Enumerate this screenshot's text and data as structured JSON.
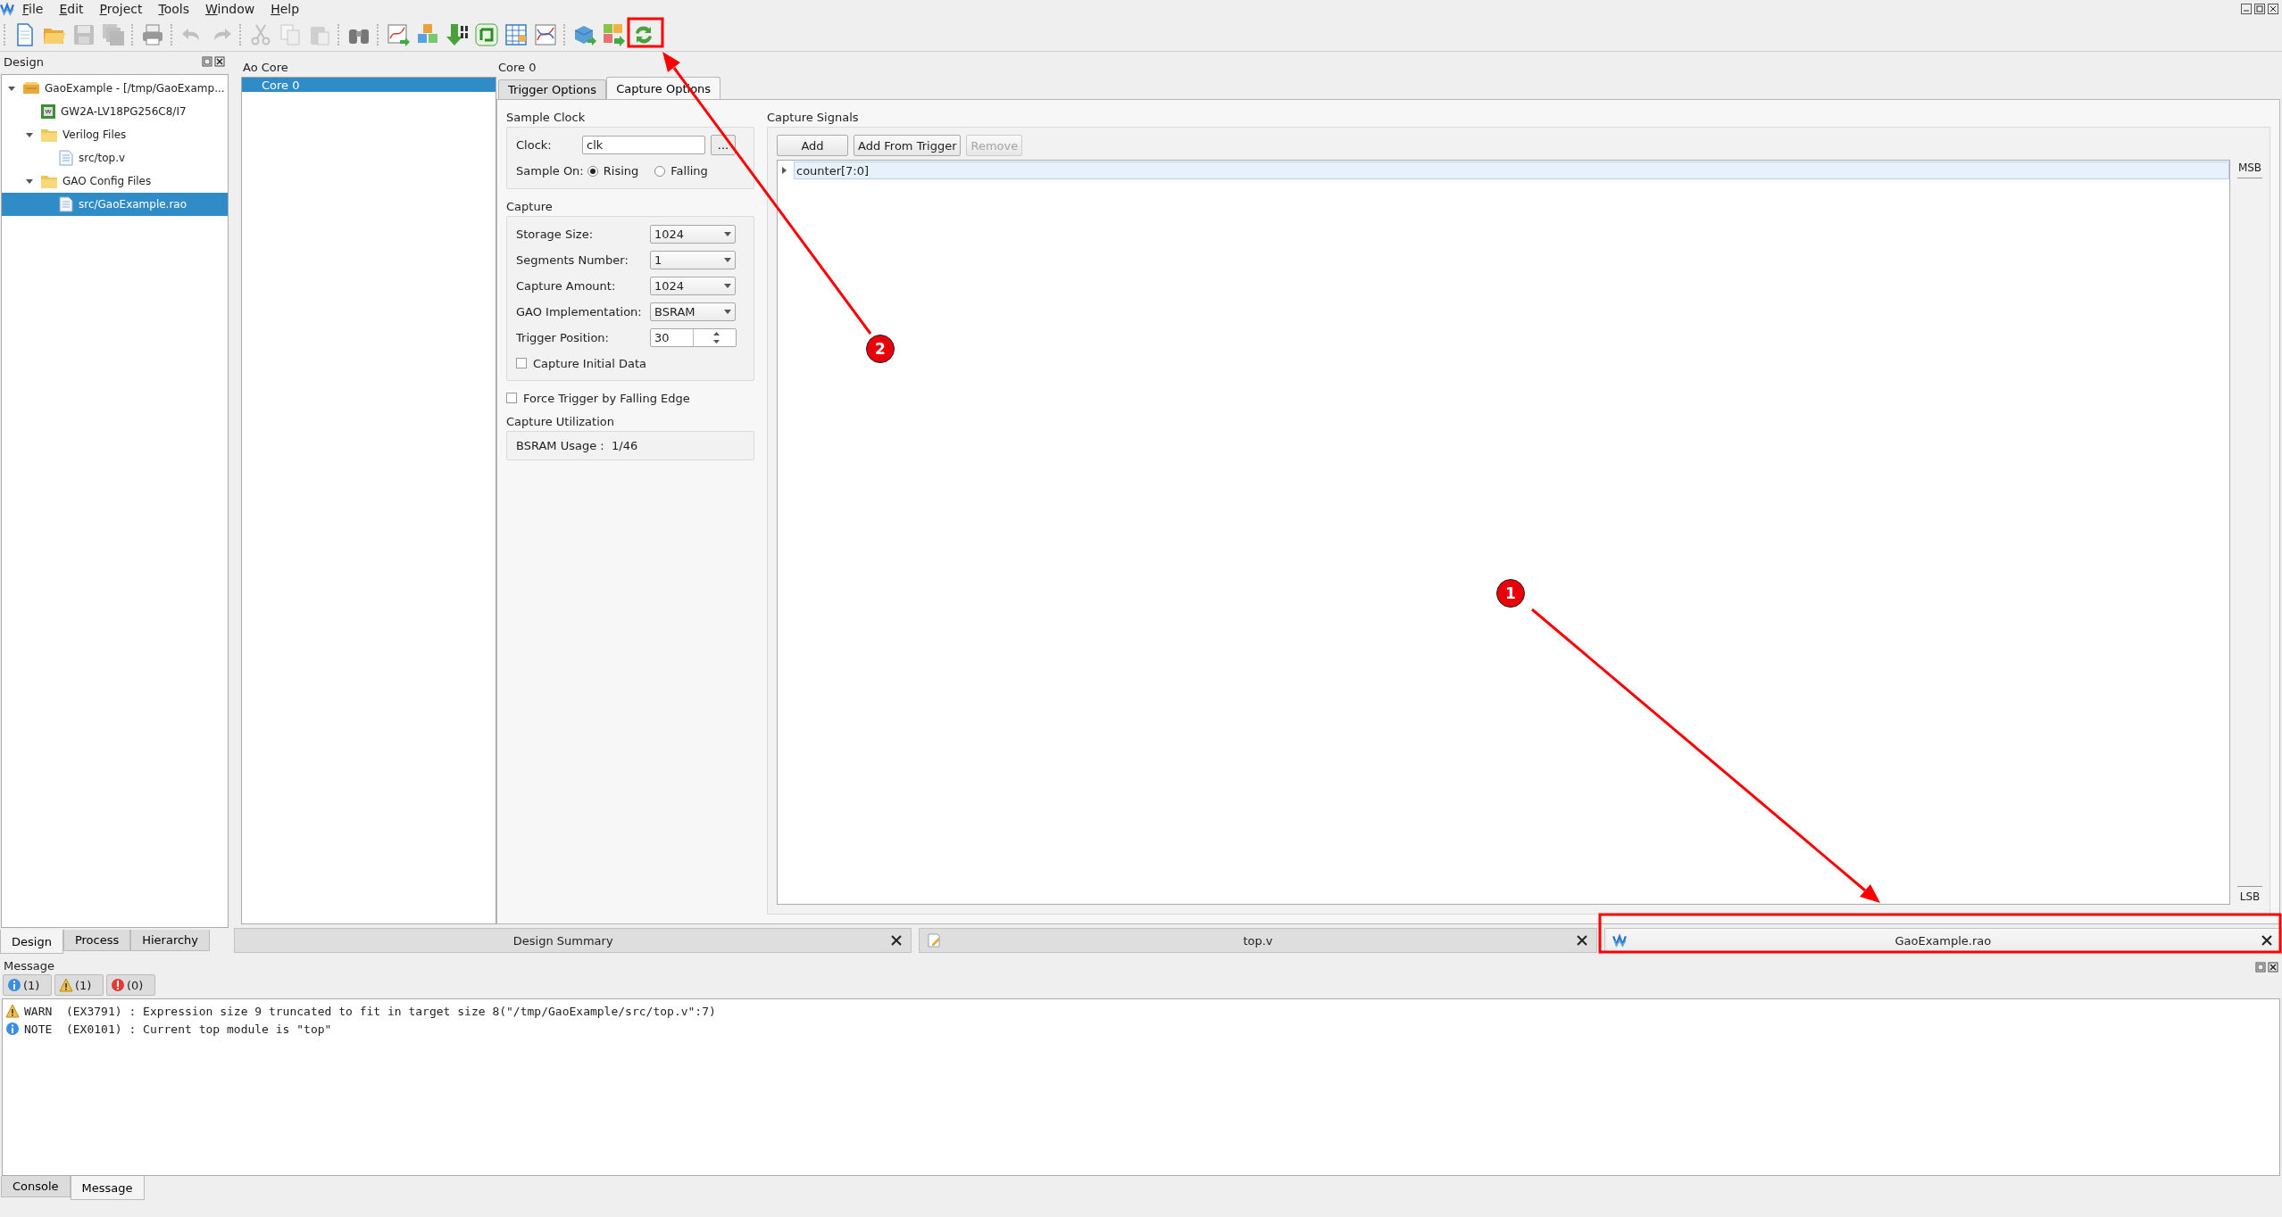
{
  "menu": [
    "File",
    "Edit",
    "Project",
    "Tools",
    "Window",
    "Help"
  ],
  "toolbar": [
    {
      "disabled": false
    },
    {
      "disabled": false
    },
    {
      "disabled": true
    },
    {
      "disabled": true
    },
    {
      "disabled": false
    },
    {
      "disabled": true
    },
    {
      "disabled": true
    },
    {
      "disabled": true
    },
    {
      "disabled": true
    },
    {
      "disabled": true
    },
    {
      "disabled": false
    },
    {
      "disabled": false
    },
    {
      "disabled": false
    },
    {
      "disabled": false
    },
    {
      "disabled": false
    },
    {
      "disabled": false
    },
    {
      "disabled": false
    },
    {
      "disabled": false
    },
    {
      "disabled": false
    },
    {
      "disabled": false
    }
  ],
  "design_panel": {
    "title": "Design",
    "tree": [
      {
        "label": "GaoExample - [/tmp/GaoExamp...",
        "kind": "project",
        "expanded": true,
        "selected": false,
        "children": [
          {
            "label": "GW2A-LV18PG256C8/I7",
            "kind": "device",
            "selected": false
          },
          {
            "label": "Verilog Files",
            "kind": "folder",
            "expanded": true,
            "selected": false,
            "children": [
              {
                "label": "src/top.v",
                "kind": "file",
                "selected": false
              }
            ]
          },
          {
            "label": "GAO Config Files",
            "kind": "folder",
            "expanded": true,
            "selected": false,
            "children": [
              {
                "label": "src/GaoExample.rao",
                "kind": "file",
                "selected": true
              }
            ]
          }
        ]
      }
    ],
    "tabs": [
      {
        "label": "Design",
        "selected": true
      },
      {
        "label": "Process",
        "selected": false
      },
      {
        "label": "Hierarchy",
        "selected": false
      }
    ]
  },
  "ao_core": {
    "title": "Ao Core",
    "items": [
      {
        "label": "Core 0",
        "selected": true
      }
    ]
  },
  "core_panel": {
    "title": "Core 0",
    "tabs": [
      {
        "label": "Trigger Options",
        "selected": false
      },
      {
        "label": "Capture Options",
        "selected": true
      }
    ],
    "sample_clock": {
      "title": "Sample Clock",
      "clock_label": "Clock:",
      "clock_value": "clk",
      "browse_label": "...",
      "sample_on_label": "Sample On:",
      "options": [
        {
          "label": "Rising",
          "selected": true
        },
        {
          "label": "Falling",
          "selected": false
        }
      ]
    },
    "capture": {
      "title": "Capture",
      "fields": [
        {
          "kind": "dropdown",
          "label": "Storage Size:",
          "value": "1024"
        },
        {
          "kind": "dropdown",
          "label": "Segments Number:",
          "value": "1"
        },
        {
          "kind": "dropdown",
          "label": "Capture Amount:",
          "value": "1024"
        },
        {
          "kind": "dropdown",
          "label": "GAO Implementation:",
          "value": "BSRAM"
        },
        {
          "kind": "spinbox",
          "label": "Trigger Position:",
          "value": "30"
        }
      ],
      "capture_initial": {
        "label": "Capture Initial Data",
        "checked": false
      }
    },
    "force_trigger": {
      "label": "Force Trigger by Falling Edge",
      "checked": false
    },
    "utilization": {
      "title": "Capture Utilization",
      "label": "BSRAM Usage :",
      "value": "1/46"
    },
    "capture_signals": {
      "title": "Capture Signals",
      "buttons": [
        {
          "label": "Add",
          "disabled": false
        },
        {
          "label": "Add From Trigger",
          "disabled": false
        },
        {
          "label": "Remove",
          "disabled": true
        }
      ],
      "signals": [
        {
          "label": "counter[7:0]",
          "expanded": false,
          "selected": true
        }
      ],
      "msb": "MSB",
      "lsb": "LSB"
    }
  },
  "document_tabs": [
    {
      "label": "Design Summary",
      "kind": "summary",
      "selected": false
    },
    {
      "label": "top.v",
      "kind": "verilog",
      "selected": false
    },
    {
      "label": "GaoExample.rao",
      "kind": "gao",
      "selected": true
    }
  ],
  "message_panel": {
    "title": "Message",
    "filters": [
      {
        "kind": "info",
        "count": "(1)"
      },
      {
        "kind": "warning",
        "count": "(1)"
      },
      {
        "kind": "error",
        "count": "(0)"
      }
    ],
    "lines": [
      {
        "kind": "warning",
        "text": "WARN  (EX3791) : Expression size 9 truncated to fit in target size 8(\"/tmp/GaoExample/src/top.v\":7)"
      },
      {
        "kind": "info",
        "text": "NOTE  (EX0101) : Current top module is \"top\""
      }
    ],
    "tabs": [
      {
        "label": "Console",
        "selected": false
      },
      {
        "label": "Message",
        "selected": true
      }
    ]
  },
  "annotations": [
    {
      "label": "1"
    },
    {
      "label": "2"
    }
  ]
}
